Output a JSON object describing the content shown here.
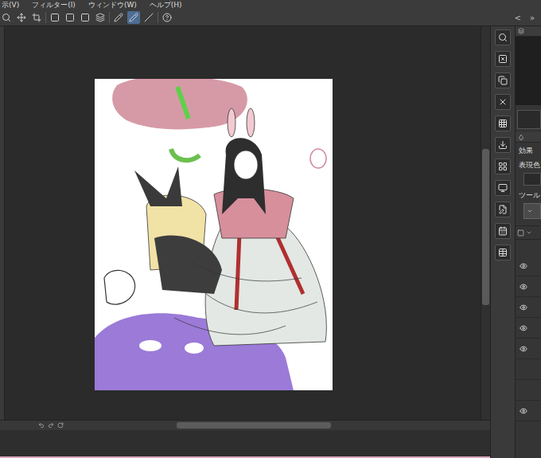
{
  "menu": [
    "示(V)",
    "フィルター(I)",
    "ウィンドウ(W)",
    "ヘルプ(H)"
  ],
  "toolbar": [
    {
      "selected": false
    },
    {
      "selected": false
    },
    {
      "selected": false
    },
    {
      "selected": false
    },
    {
      "selected": false
    },
    {
      "selected": false
    },
    {
      "selected": false
    },
    {
      "selected": false
    },
    {
      "selected": true
    },
    {
      "selected": false
    },
    {
      "selected": false
    }
  ],
  "panel_controls": [
    "<",
    "»"
  ],
  "right_panel": {
    "labels": [
      "効果",
      "表現色",
      "ツール"
    ]
  },
  "layers": [
    {
      "visible": true
    },
    {
      "visible": true
    },
    {
      "visible": true
    },
    {
      "visible": true
    },
    {
      "visible": true
    },
    {
      "visible": false
    },
    {
      "visible": false
    },
    {
      "visible": true
    }
  ],
  "vertical_scroll": {
    "start": 0.31,
    "level": 0.4
  },
  "horizontal_scroll": {
    "start": 0.25,
    "level": 0.38
  }
}
